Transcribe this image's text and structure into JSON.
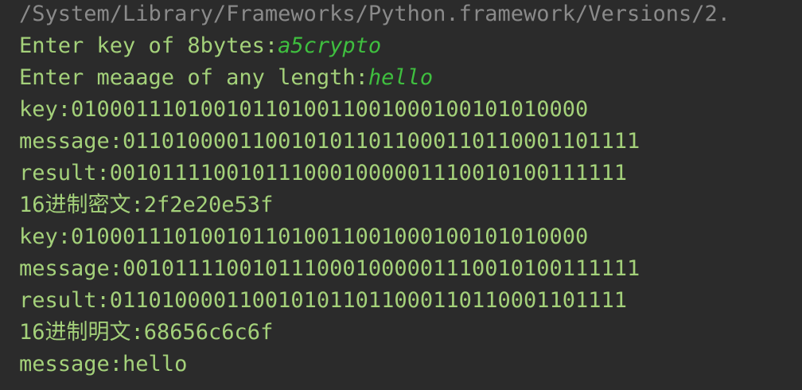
{
  "console": {
    "path_line": "/System/Library/Frameworks/Python.framework/Versions/2.",
    "lines": [
      {
        "prompt": "Enter key of 8bytes:",
        "input": "a5crypto"
      },
      {
        "prompt": "Enter meaage of any length:",
        "input": "hello"
      },
      {
        "text": "key:0100011101001011010011001000100101010000"
      },
      {
        "text": "message:0110100001100101011011000110110001101111"
      },
      {
        "text": "result:0010111100101110001000001110010100111111"
      },
      {
        "text": "16进制密文:2f2e20e53f"
      },
      {
        "text": "key:0100011101001011010011001000100101010000"
      },
      {
        "text": "message:0010111100101110001000001110010100111111"
      },
      {
        "text": "result:0110100001100101011011000110110001101111"
      },
      {
        "text": "16进制明文:68656c6c6f"
      },
      {
        "text": "message:hello"
      }
    ]
  },
  "colors": {
    "background": "#2b2b2b",
    "output_text": "#a4d17a",
    "user_input": "#3fbf3f",
    "path_text": "#8a8a8a"
  }
}
